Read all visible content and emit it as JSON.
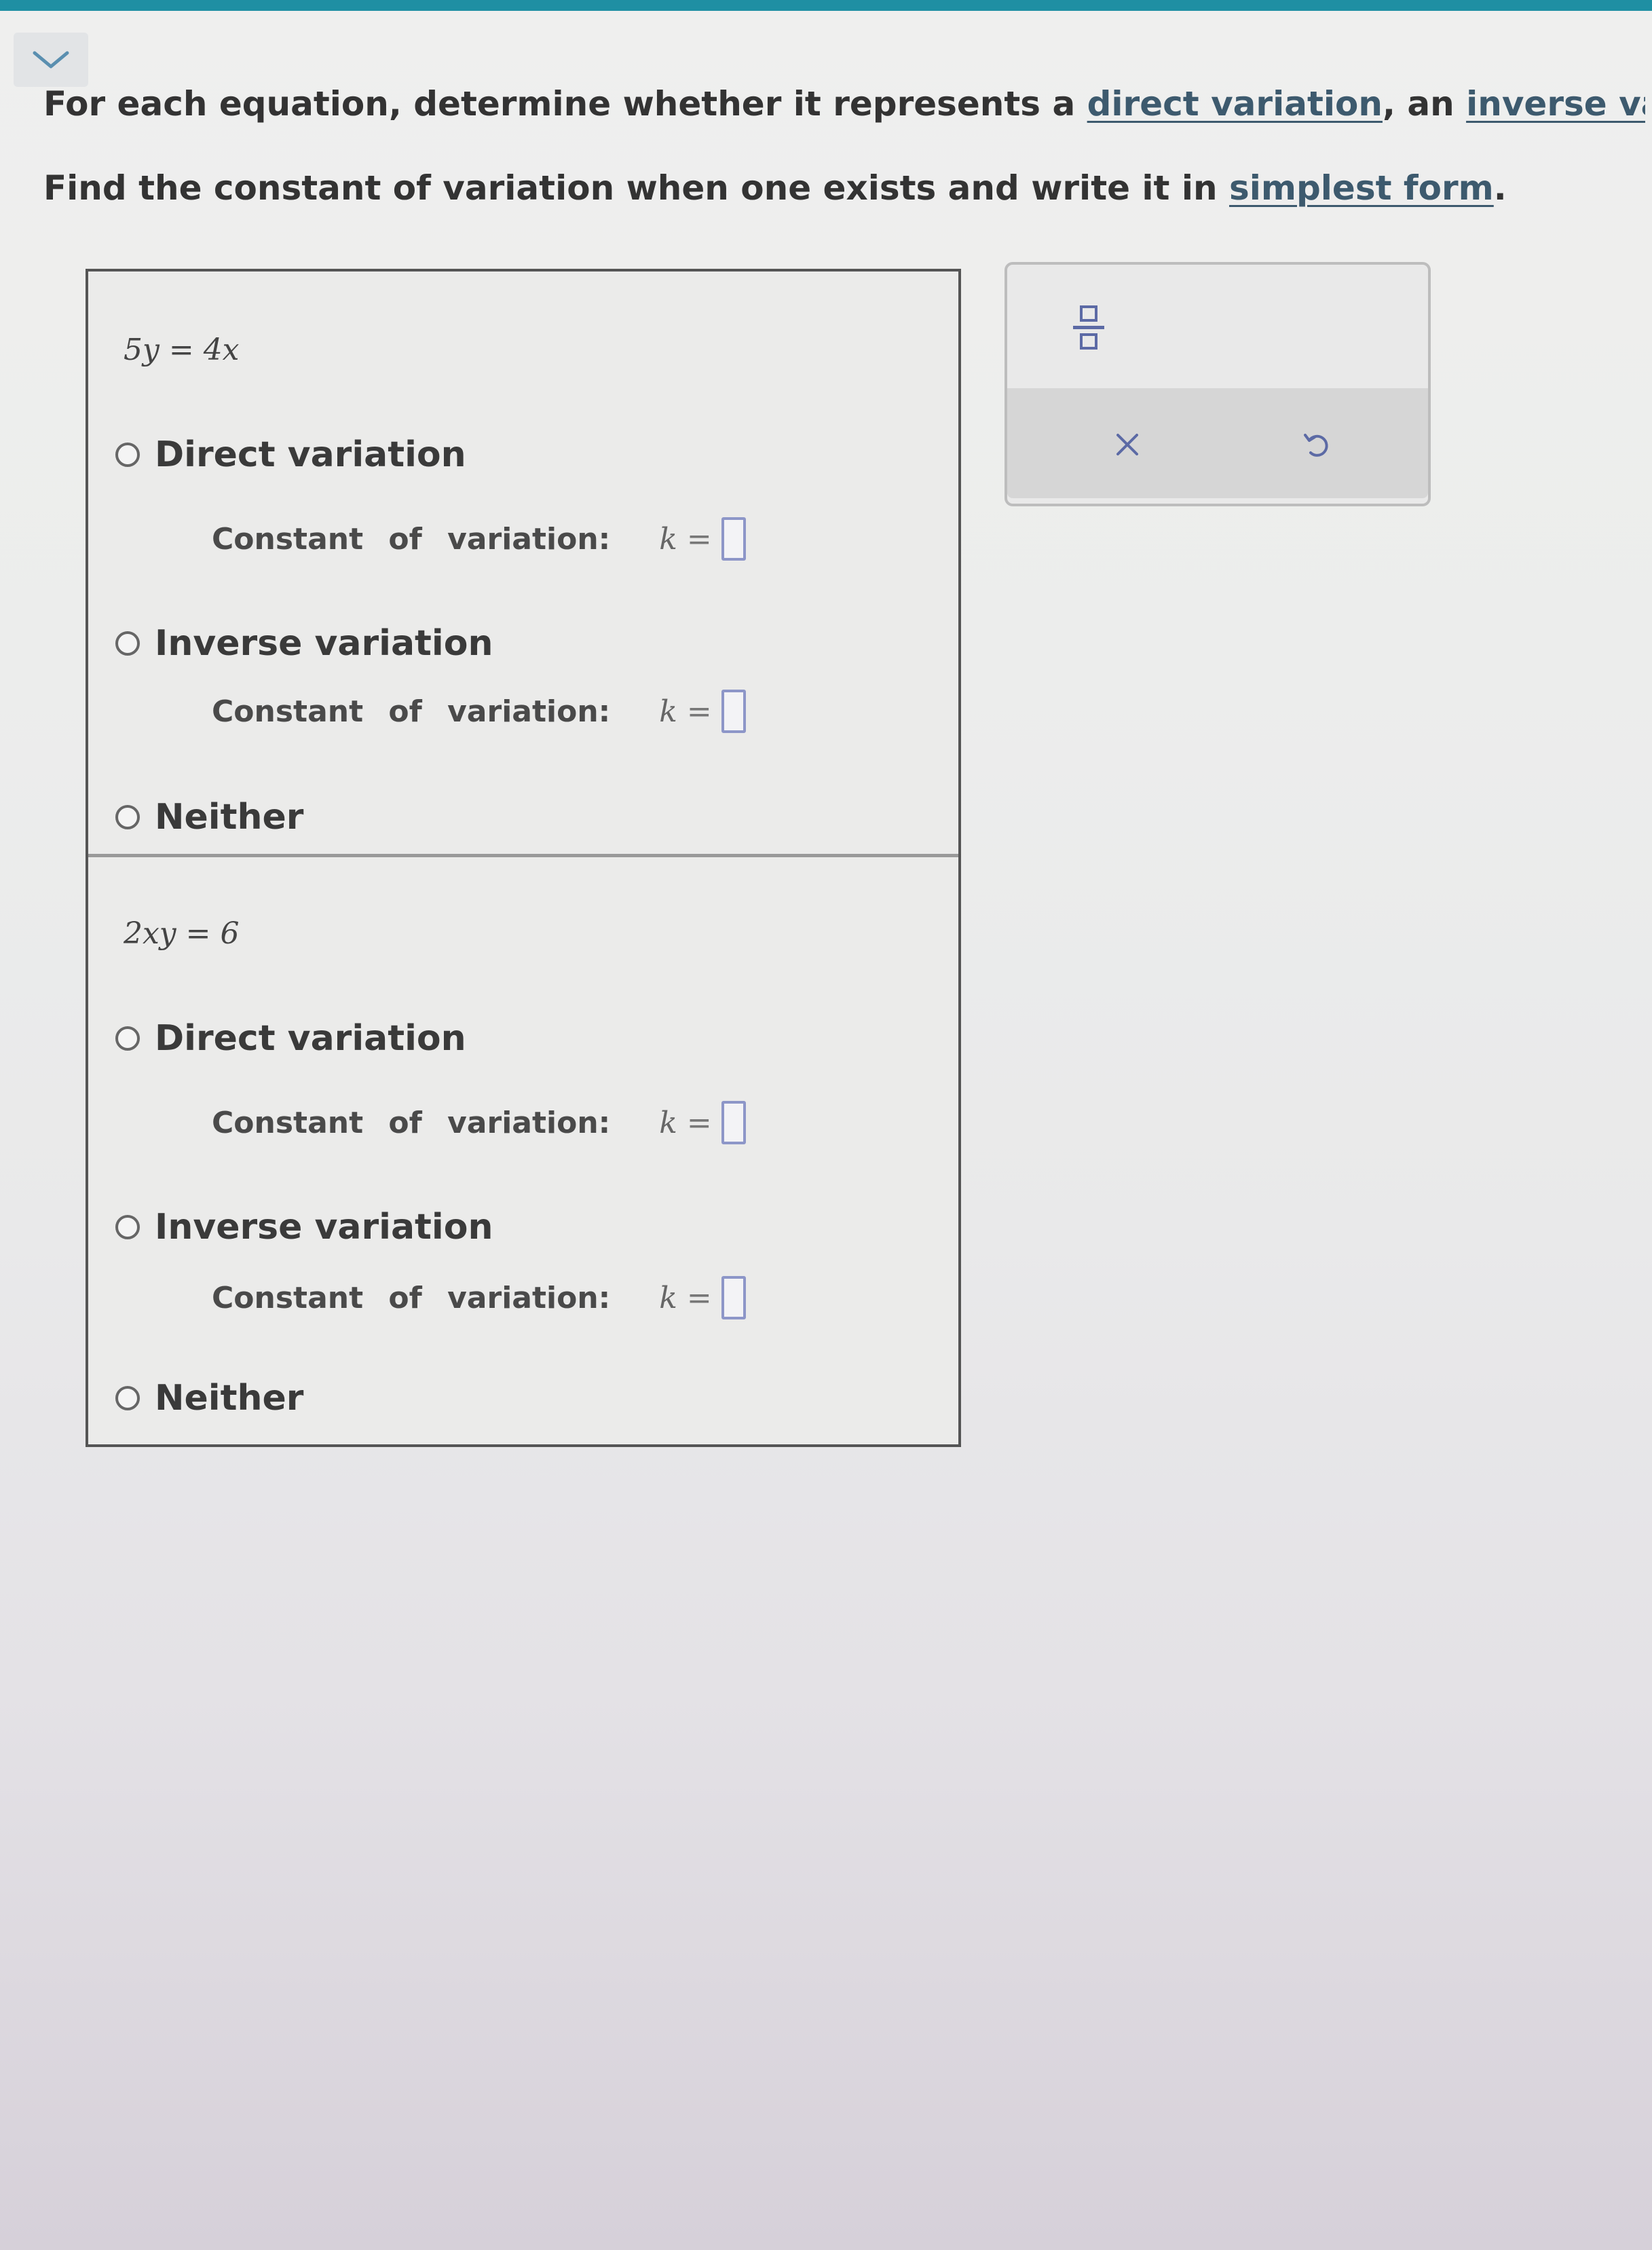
{
  "header": {
    "collapse_icon": "chevron-down-icon"
  },
  "instructions": {
    "line1_prefix": "For each equation, determine whether it represents a ",
    "link_direct": "direct variation",
    "line1_mid": ", an ",
    "link_inverse": "inverse variati",
    "line2_prefix": "Find the constant of variation when one exists and write it in ",
    "link_simplest": "simplest form",
    "line2_suffix": "."
  },
  "questions": [
    {
      "equation": "5y = 4x",
      "options": {
        "direct": "Direct variation",
        "inverse": "Inverse variation",
        "neither": "Neither"
      },
      "constant_label": "Constant of variation:",
      "k_label": "k",
      "equals": "="
    },
    {
      "equation": "2xy = 6",
      "options": {
        "direct": "Direct variation",
        "inverse": "Inverse variation",
        "neither": "Neither"
      },
      "constant_label": "Constant of variation:",
      "k_label": "k",
      "equals": "="
    }
  ],
  "toolbar": {
    "fraction_icon": "fraction-icon",
    "clear_icon": "close-icon",
    "undo_icon": "undo-icon"
  },
  "colors": {
    "top_bar": "#1f8fa3",
    "link": "#3d5a6e",
    "answer_box_border": "#8d96c8",
    "tool_icon": "#5c6aa5"
  }
}
